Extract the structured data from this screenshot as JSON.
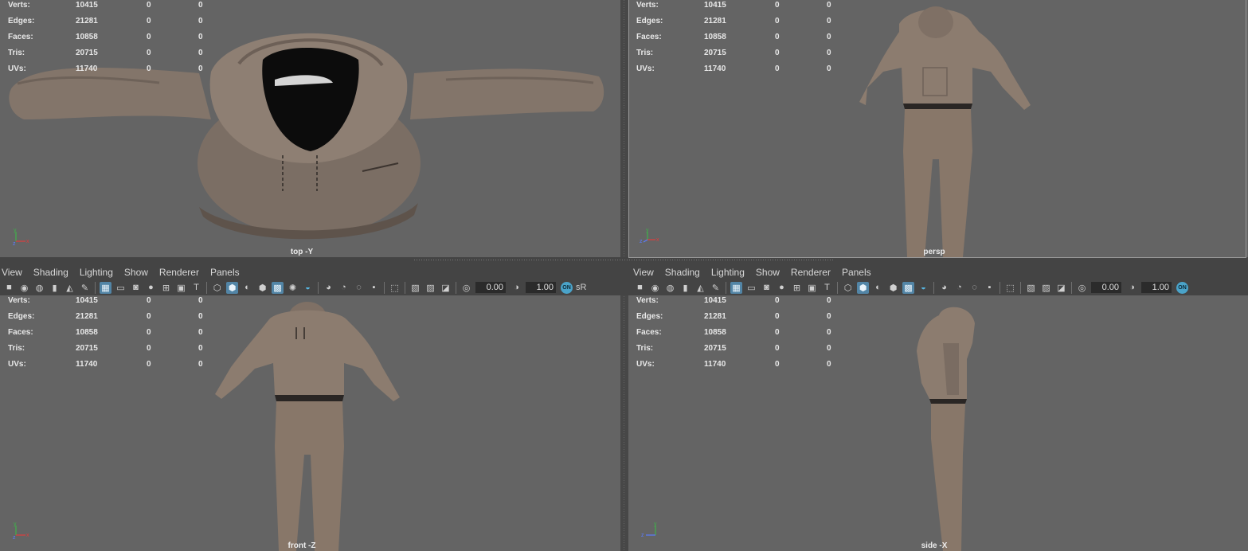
{
  "stats": [
    {
      "label": "Verts:",
      "value": "10415",
      "a": "0",
      "b": "0"
    },
    {
      "label": "Edges:",
      "value": "21281",
      "a": "0",
      "b": "0"
    },
    {
      "label": "Faces:",
      "value": "10858",
      "a": "0",
      "b": "0"
    },
    {
      "label": "Tris:",
      "value": "20715",
      "a": "0",
      "b": "0"
    },
    {
      "label": "UVs:",
      "value": "11740",
      "a": "0",
      "b": "0"
    }
  ],
  "viewports": {
    "top": {
      "camera": "top -Y"
    },
    "persp": {
      "camera": "persp"
    },
    "front": {
      "camera": "front -Z"
    },
    "side": {
      "camera": "side -X"
    }
  },
  "menu": [
    "View",
    "Shading",
    "Lighting",
    "Show",
    "Renderer",
    "Panels"
  ],
  "toolbar": {
    "exposure": "0.00",
    "gamma": "1.00",
    "srgb_label": "sR",
    "on_label": "ON"
  },
  "axis_labels": {
    "x": "x",
    "y": "y",
    "z": "z"
  },
  "colors": {
    "viewport_bg": "#646464",
    "cloth": "#8a7a6d",
    "cloth_dark": "#5d5149",
    "selected": "#5285a6"
  },
  "icons": [
    "camera-icon",
    "camera-select-icon",
    "camera-attr-icon",
    "bookmark-icon",
    "image-plane-icon",
    "grease-pencil-icon",
    "grid-icon",
    "film-gate-icon",
    "resolution-gate-icon",
    "gate-mask-icon",
    "field-chart-icon",
    "safe-action-icon",
    "safe-title-icon",
    "wireframe-icon",
    "smooth-shade-icon",
    "default-material-icon",
    "wireframe-on-shaded-icon",
    "xray-icon",
    "lights-icon",
    "shadows-icon",
    "ambient-occlusion-icon",
    "motion-blur-icon",
    "antialias-icon",
    "depth-of-field-icon",
    "isolate-select-icon",
    "xray-joints-icon",
    "xray-active-icon",
    "backface-icon",
    "exposure-icon",
    "gamma-icon",
    "color-management-icon"
  ]
}
